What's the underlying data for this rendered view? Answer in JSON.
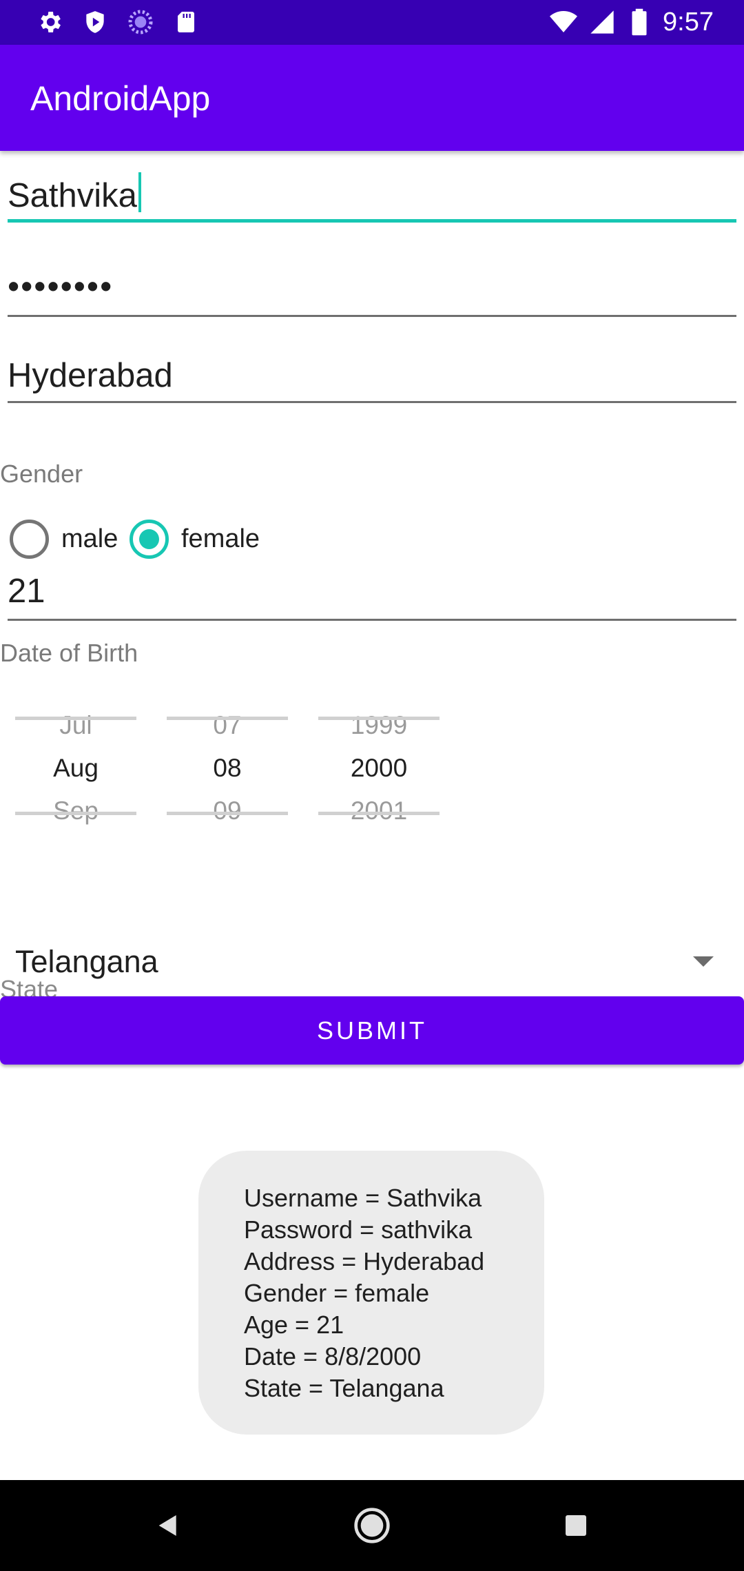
{
  "status_bar": {
    "time": "9:57",
    "left_icons": [
      "gear-icon",
      "shield-icon",
      "sync-circle-icon",
      "sd-card-icon"
    ],
    "right_icons": [
      "wifi-icon",
      "signal-icon",
      "battery-icon"
    ]
  },
  "app_bar": {
    "title": "AndroidApp"
  },
  "form": {
    "username": {
      "value": "Sathvika"
    },
    "password": {
      "value": "••••••••"
    },
    "address": {
      "value": "Hyderabad"
    },
    "gender": {
      "label": "Gender",
      "options": [
        {
          "label": "male",
          "checked": false
        },
        {
          "label": "female",
          "checked": true
        }
      ]
    },
    "age": {
      "value": "21"
    },
    "dob": {
      "label": "Date of Birth",
      "month": {
        "prev": "Jul",
        "current": "Aug",
        "next": "Sep"
      },
      "day": {
        "prev": "07",
        "current": "08",
        "next": "09"
      },
      "year": {
        "prev": "1999",
        "current": "2000",
        "next": "2001"
      }
    },
    "state": {
      "value": "Telangana",
      "label": "State"
    },
    "submit_label": "SUBMIT"
  },
  "toast": {
    "lines": [
      "Username = Sathvika",
      "Password = sathvika",
      "Address = Hyderabad",
      "Gender = female",
      "Age = 21",
      "Date = 8/8/2000",
      "State = Telangana"
    ]
  },
  "nav_bar": {
    "icons": [
      "back-icon",
      "home-icon",
      "recents-icon"
    ]
  },
  "colors": {
    "status_bar": "#3700b3",
    "primary": "#6200ee",
    "accent": "#17c7b3",
    "toast_bg": "#ececec"
  }
}
